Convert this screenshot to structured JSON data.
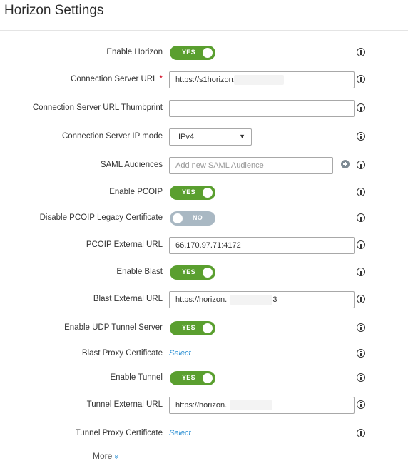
{
  "page": {
    "title": "Horizon Settings"
  },
  "fields": {
    "enable_horizon": {
      "label": "Enable Horizon",
      "toggle": "YES",
      "on": true
    },
    "connection_server_url": {
      "label": "Connection Server URL",
      "required": "*",
      "value": "https://s1horizon."
    },
    "thumbprint": {
      "label": "Connection Server URL Thumbprint",
      "value": ""
    },
    "ip_mode": {
      "label": "Connection Server IP mode",
      "value": "IPv4",
      "caret": "▼"
    },
    "saml": {
      "label": "SAML Audiences",
      "placeholder": "Add new SAML Audience"
    },
    "enable_pcoip": {
      "label": "Enable PCOIP",
      "toggle": "YES",
      "on": true
    },
    "disable_pcoip_legacy": {
      "label": "Disable PCOIP Legacy Certificate",
      "toggle": "NO",
      "on": false
    },
    "pcoip_external_url": {
      "label": "PCOIP External URL",
      "value": "66.170.97.71:4172"
    },
    "enable_blast": {
      "label": "Enable Blast",
      "toggle": "YES",
      "on": true
    },
    "blast_external_url": {
      "label": "Blast External URL",
      "value": "https://horizon.              :8443"
    },
    "enable_udp": {
      "label": "Enable UDP Tunnel Server",
      "toggle": "YES",
      "on": true
    },
    "blast_proxy_cert": {
      "label": "Blast Proxy Certificate",
      "link": "Select"
    },
    "enable_tunnel": {
      "label": "Enable Tunnel",
      "toggle": "YES",
      "on": true
    },
    "tunnel_external_url": {
      "label": "Tunnel External URL",
      "value": "https://horizon.              :443"
    },
    "tunnel_proxy_cert": {
      "label": "Tunnel Proxy Certificate",
      "link": "Select"
    }
  },
  "more": {
    "label": "More",
    "chevron": "»"
  },
  "icons": {
    "info": "info-circle-icon",
    "add": "plus-circle-icon"
  },
  "colors": {
    "toggle_on": "#5a9f2f",
    "toggle_off": "#a9b8c3",
    "link": "#2a8fd3",
    "required": "#d0021b"
  }
}
